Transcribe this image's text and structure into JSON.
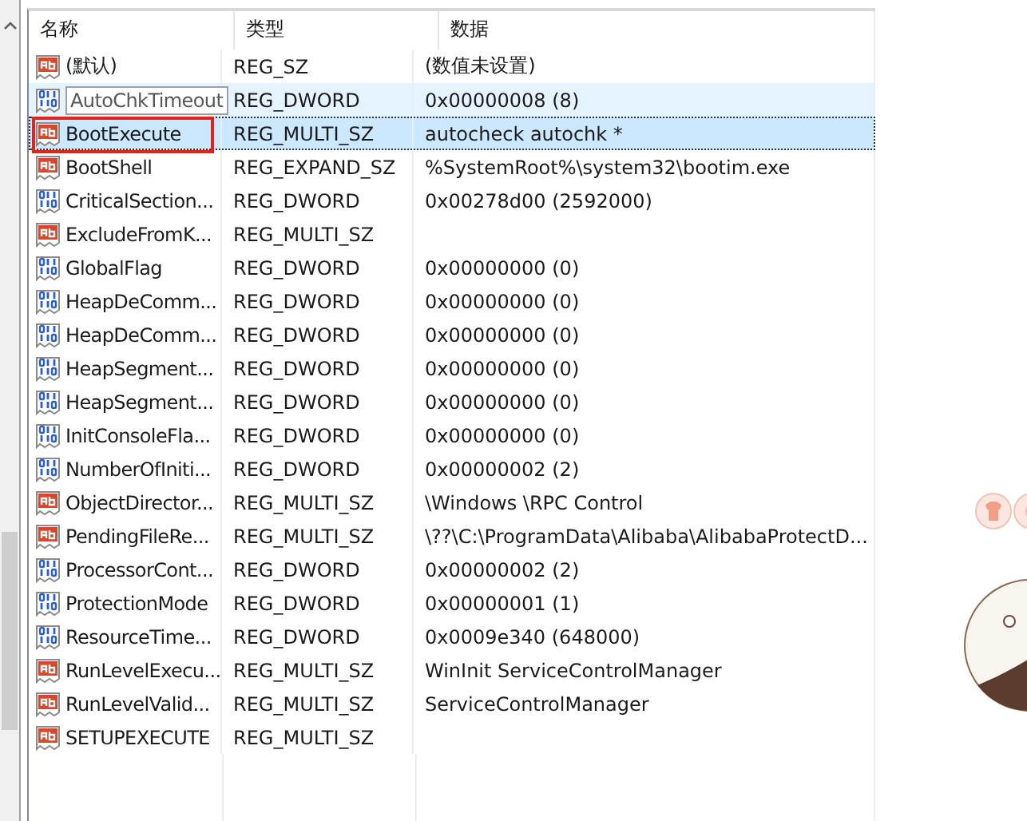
{
  "columns": [
    "名称",
    "类型",
    "数据"
  ],
  "rows": [
    {
      "kind": "string",
      "name": "(默认)",
      "type": "REG_SZ",
      "data": "(数值未设置)",
      "hovered": false,
      "selected": false,
      "annotated": false
    },
    {
      "kind": "dword",
      "name": "AutoChkTimeout",
      "type": "REG_DWORD",
      "data": "0x00000008 (8)",
      "hovered": true,
      "selected": false,
      "annotated": false
    },
    {
      "kind": "string",
      "name": "BootExecute",
      "type": "REG_MULTI_SZ",
      "data": "autocheck autochk *",
      "hovered": false,
      "selected": true,
      "annotated": true
    },
    {
      "kind": "string",
      "name": "BootShell",
      "type": "REG_EXPAND_SZ",
      "data": "%SystemRoot%\\system32\\bootim.exe",
      "hovered": false,
      "selected": false,
      "annotated": false
    },
    {
      "kind": "dword",
      "name": "CriticalSection...",
      "type": "REG_DWORD",
      "data": "0x00278d00 (2592000)",
      "hovered": false,
      "selected": false,
      "annotated": false
    },
    {
      "kind": "string",
      "name": "ExcludeFromK...",
      "type": "REG_MULTI_SZ",
      "hovered": false,
      "selected": false,
      "annotated": false
    },
    {
      "kind": "dword",
      "name": "GlobalFlag",
      "type": "REG_DWORD",
      "data": "0x00000000 (0)",
      "hovered": false,
      "selected": false,
      "annotated": false
    },
    {
      "kind": "dword",
      "name": "HeapDeComm...",
      "type": "REG_DWORD",
      "data": "0x00000000 (0)",
      "hovered": false,
      "selected": false,
      "annotated": false
    },
    {
      "kind": "dword",
      "name": "HeapDeComm...",
      "type": "REG_DWORD",
      "data": "0x00000000 (0)",
      "hovered": false,
      "selected": false,
      "annotated": false
    },
    {
      "kind": "dword",
      "name": "HeapSegment...",
      "type": "REG_DWORD",
      "data": "0x00000000 (0)",
      "hovered": false,
      "selected": false,
      "annotated": false
    },
    {
      "kind": "dword",
      "name": "HeapSegment...",
      "type": "REG_DWORD",
      "data": "0x00000000 (0)",
      "hovered": false,
      "selected": false,
      "annotated": false
    },
    {
      "kind": "dword",
      "name": "InitConsoleFla...",
      "type": "REG_DWORD",
      "data": "0x00000000 (0)",
      "hovered": false,
      "selected": false,
      "annotated": false
    },
    {
      "kind": "dword",
      "name": "NumberOfIniti...",
      "type": "REG_DWORD",
      "data": "0x00000002 (2)",
      "hovered": false,
      "selected": false,
      "annotated": false
    },
    {
      "kind": "string",
      "name": "ObjectDirector...",
      "type": "REG_MULTI_SZ",
      "data": "\\Windows \\RPC Control",
      "hovered": false,
      "selected": false,
      "annotated": false
    },
    {
      "kind": "string",
      "name": "PendingFileRe...",
      "type": "REG_MULTI_SZ",
      "data": "\\??\\C:\\ProgramData\\Alibaba\\AlibabaProtectD...",
      "hovered": false,
      "selected": false,
      "annotated": false
    },
    {
      "kind": "dword",
      "name": "ProcessorCont...",
      "type": "REG_DWORD",
      "data": "0x00000002 (2)",
      "hovered": false,
      "selected": false,
      "annotated": false
    },
    {
      "kind": "dword",
      "name": "ProtectionMode",
      "type": "REG_DWORD",
      "data": "0x00000001 (1)",
      "hovered": false,
      "selected": false,
      "annotated": false
    },
    {
      "kind": "dword",
      "name": "ResourceTime...",
      "type": "REG_DWORD",
      "data": "0x0009e340 (648000)",
      "hovered": false,
      "selected": false,
      "annotated": false
    },
    {
      "kind": "string",
      "name": "RunLevelExecu...",
      "type": "REG_MULTI_SZ",
      "data": "WinInit ServiceControlManager",
      "hovered": false,
      "selected": false,
      "annotated": false
    },
    {
      "kind": "string",
      "name": "RunLevelValid...",
      "type": "REG_MULTI_SZ",
      "data": "ServiceControlManager",
      "hovered": false,
      "selected": false,
      "annotated": false
    },
    {
      "kind": "string",
      "name": "SETUPEXECUTE",
      "type": "REG_MULTI_SZ",
      "hovered": false,
      "selected": false,
      "annotated": false
    }
  ]
}
